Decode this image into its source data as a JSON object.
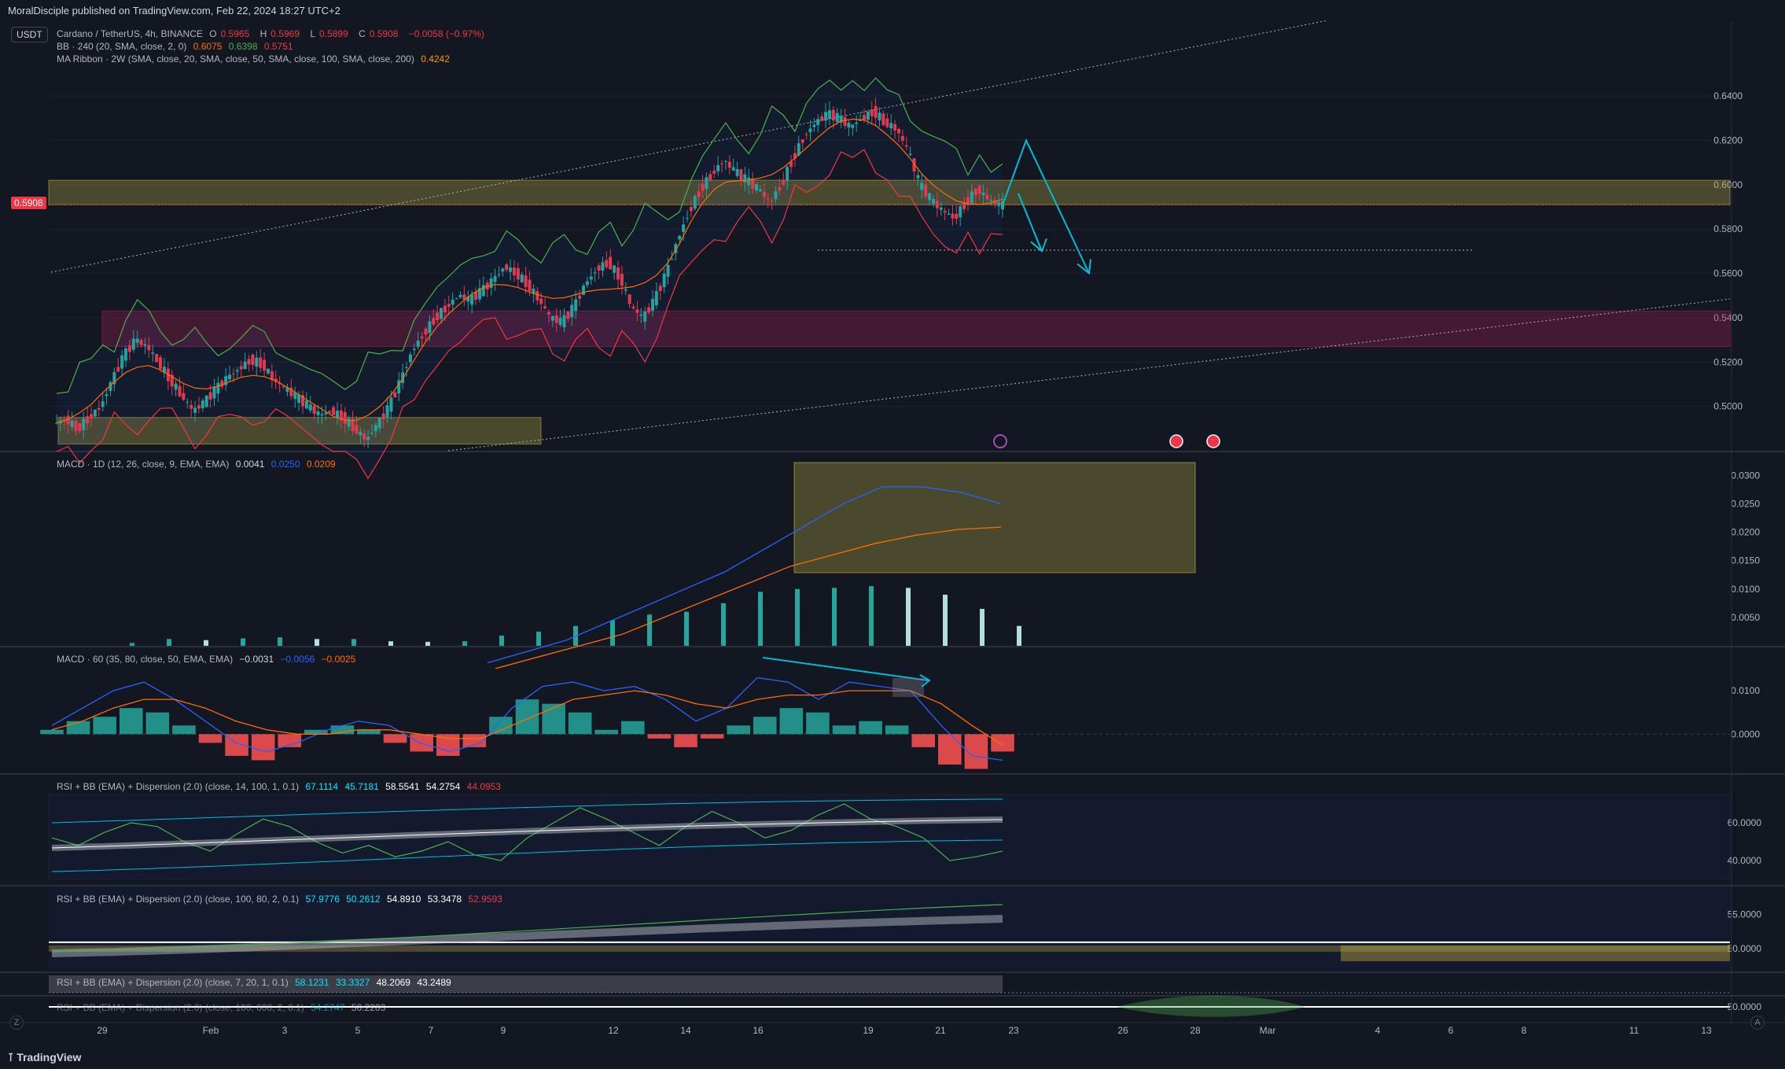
{
  "header": {
    "publisher_line": "MoralDisciple published on TradingView.com, Feb 22, 2024 18:27 UTC+2"
  },
  "symbol_button": "USDT",
  "legend_main": {
    "title": "Cardano / TetherUS, 4h, BINANCE",
    "o_label": "O",
    "o": "0.5965",
    "h_label": "H",
    "h": "0.5969",
    "l_label": "L",
    "l": "0.5899",
    "c_label": "C",
    "c": "0.5908",
    "change": "−0.0058 (−0.97%)"
  },
  "legend_bb": {
    "label": "BB · 240 (20, SMA, close, 2, 0)",
    "v1": "0.6075",
    "v2": "0.6398",
    "v3": "0.5751"
  },
  "legend_ma": {
    "label": "MA Ribbon · 2W (SMA, close, 20, SMA, close, 50, SMA, close, 100, SMA, close, 200)",
    "v1": "0.4242"
  },
  "legend_macd1": {
    "label": "MACD · 1D (12, 26, close, 9, EMA, EMA)",
    "v1": "0.0041",
    "v2": "0.0250",
    "v3": "0.0209"
  },
  "legend_macd2": {
    "label": "MACD · 60 (35, 80, close, 50, EMA, EMA)",
    "v1": "−0.0031",
    "v2": "−0.0056",
    "v3": "−0.0025"
  },
  "legend_rsi1": {
    "label": "RSI + BB (EMA) + Dispersion (2.0) (close, 14, 100, 1, 0.1)",
    "v1": "67.1114",
    "v2": "45.7181",
    "v3": "58.5541",
    "v4": "54.2754",
    "v5": "44.0953"
  },
  "legend_rsi2": {
    "label": "RSI + BB (EMA) + Dispersion (2.0) (close, 100, 80, 2, 0.1)",
    "v1": "57.9776",
    "v2": "50.2612",
    "v3": "54.8910",
    "v4": "53.3478",
    "v5": "52.9593"
  },
  "legend_rsi3": {
    "label": "RSI + BB (EMA) + Dispersion (2.0) (close, 7, 20, 1, 0.1)",
    "v1": "58.1231",
    "v2": "33.3327",
    "v3": "48.2069",
    "v4": "43.2489"
  },
  "legend_rsi4": {
    "label": "RSI + BB (EMA) + Dispersion (2.0) (close, 100, 600, 2, 0.1)",
    "v1": "54.2747",
    "v2": "50.2203"
  },
  "current_price_tag": "0.5908",
  "footer": {
    "brand": "TradingView"
  },
  "colors": {
    "bg": "#131722",
    "up": "#26a69a",
    "down": "#f23645",
    "blue": "#2962ff",
    "orange": "#ff6d00",
    "cyan": "#00bcd4",
    "green": "#4caf50",
    "yellow_zone": "#b5a642",
    "red_zone": "#9c1f4c"
  },
  "chart_data": [
    {
      "type": "candlestick",
      "title": "Cardano / TetherUS, 4h, BINANCE",
      "price_axis_ticks": [
        "0.6400",
        "0.6200",
        "0.6000",
        "0.5800",
        "0.5600",
        "0.5400",
        "0.5200",
        "0.5000"
      ],
      "ylim": [
        0.48,
        0.662
      ],
      "x_ticks": [
        "29",
        "Feb",
        "3",
        "5",
        "7",
        "9",
        "12",
        "14",
        "16",
        "19",
        "21",
        "23",
        "26",
        "28",
        "Mar",
        "4",
        "6",
        "8",
        "11",
        "13"
      ],
      "close_path": [
        0.492,
        0.494,
        0.49,
        0.495,
        0.5,
        0.512,
        0.523,
        0.53,
        0.527,
        0.52,
        0.512,
        0.505,
        0.498,
        0.502,
        0.508,
        0.513,
        0.517,
        0.521,
        0.519,
        0.512,
        0.508,
        0.504,
        0.5,
        0.496,
        0.498,
        0.495,
        0.49,
        0.485,
        0.492,
        0.5,
        0.512,
        0.525,
        0.533,
        0.54,
        0.545,
        0.55,
        0.548,
        0.552,
        0.557,
        0.563,
        0.56,
        0.555,
        0.548,
        0.54,
        0.538,
        0.545,
        0.555,
        0.562,
        0.565,
        0.558,
        0.545,
        0.54,
        0.548,
        0.56,
        0.575,
        0.588,
        0.598,
        0.605,
        0.611,
        0.606,
        0.602,
        0.598,
        0.592,
        0.6,
        0.612,
        0.622,
        0.628,
        0.632,
        0.63,
        0.626,
        0.63,
        0.633,
        0.628,
        0.625,
        0.615,
        0.6,
        0.593,
        0.588,
        0.585,
        0.592,
        0.598,
        0.593,
        0.5908
      ],
      "forecast_arrows": [
        [
          0.5908,
          0.62,
          0.56
        ],
        [
          0.5908,
          0.57
        ]
      ],
      "zones": [
        {
          "from": 0.591,
          "to": 0.602,
          "color": "yellow"
        },
        {
          "from": 0.527,
          "to": 0.543,
          "color": "red"
        },
        {
          "from": 0.483,
          "to": 0.495,
          "color": "yellow"
        }
      ]
    },
    {
      "type": "bar",
      "title": "MACD · 1D (12, 26, close, 9, EMA, EMA)",
      "y_ticks": [
        "0.0300",
        "0.0250",
        "0.0200",
        "0.0150",
        "0.0100",
        "0.0050"
      ],
      "ylim": [
        0.0,
        0.032
      ],
      "histogram": [
        0.0005,
        0.0012,
        0.001,
        0.0013,
        0.0015,
        0.0012,
        0.0012,
        0.0008,
        0.0007,
        0.0008,
        0.0018,
        0.0025,
        0.0035,
        0.0045,
        0.0055,
        0.006,
        0.0075,
        0.0095,
        0.01,
        0.0102,
        0.0105,
        0.0102,
        0.009,
        0.0065,
        0.0035
      ],
      "macd_line": [
        -0.003,
        -0.001,
        0.001,
        0.004,
        0.007,
        0.01,
        0.013,
        0.017,
        0.021,
        0.025,
        0.028,
        0.028,
        0.027,
        0.025
      ],
      "signal_line": [
        -0.004,
        -0.002,
        0.0,
        0.002,
        0.005,
        0.008,
        0.011,
        0.014,
        0.016,
        0.018,
        0.0195,
        0.0205,
        0.0209
      ]
    },
    {
      "type": "bar",
      "title": "MACD · 60 (35, 80, close, 50, EMA, EMA)",
      "y_ticks": [
        "0.0100",
        "0.0000"
      ],
      "ylim": [
        -0.009,
        0.016
      ],
      "histogram": [
        0.001,
        0.003,
        0.004,
        0.006,
        0.005,
        0.002,
        -0.002,
        -0.005,
        -0.006,
        -0.003,
        0.001,
        0.002,
        0.001,
        -0.002,
        -0.004,
        -0.005,
        -0.003,
        0.004,
        0.008,
        0.007,
        0.005,
        0.001,
        0.003,
        -0.001,
        -0.003,
        -0.001,
        0.002,
        0.004,
        0.006,
        0.005,
        0.002,
        0.003,
        0.002,
        -0.003,
        -0.007,
        -0.008,
        -0.004
      ],
      "macd_line": [
        0.002,
        0.006,
        0.01,
        0.012,
        0.008,
        0.003,
        -0.002,
        -0.004,
        -0.002,
        0.001,
        0.003,
        0.002,
        -0.002,
        -0.004,
        -0.002,
        0.006,
        0.011,
        0.012,
        0.01,
        0.011,
        0.008,
        0.003,
        0.006,
        0.013,
        0.012,
        0.008,
        0.012,
        0.011,
        0.01,
        0.002,
        -0.005,
        -0.006
      ],
      "signal_line": [
        0.001,
        0.003,
        0.006,
        0.008,
        0.008,
        0.006,
        0.003,
        0.001,
        0.0,
        0.0,
        0.001,
        0.001,
        0.0,
        -0.001,
        -0.001,
        0.002,
        0.005,
        0.008,
        0.009,
        0.01,
        0.009,
        0.007,
        0.006,
        0.008,
        0.009,
        0.009,
        0.01,
        0.01,
        0.01,
        0.007,
        0.002,
        -0.0025
      ]
    },
    {
      "type": "line",
      "title": "RSI + BB (EMA) + Dispersion (2.0) (close, 14, 100, 1, 0.1)",
      "y_ticks": [
        "60.0000",
        "40.0000"
      ],
      "ylim": [
        30,
        75
      ],
      "rsi": [
        52,
        48,
        55,
        60,
        58,
        50,
        45,
        54,
        62,
        58,
        50,
        44,
        48,
        42,
        45,
        50,
        43,
        40,
        52,
        60,
        68,
        62,
        55,
        48,
        58,
        66,
        60,
        52,
        56,
        64,
        70,
        62,
        58,
        52,
        40,
        42,
        45
      ]
    },
    {
      "type": "line",
      "title": "RSI + BB (EMA) + Dispersion (2.0) (close, 100, 80, 2, 0.1)",
      "y_ticks": [
        "55.0000",
        "50.0000"
      ],
      "ylim": [
        47,
        57
      ]
    },
    {
      "type": "line",
      "title": "RSI + BB (EMA) + Dispersion (2.0) (close, 7, 20, 1, 0.1)",
      "y_ticks": []
    },
    {
      "type": "line",
      "title": "RSI + BB (EMA) + Dispersion (2.0) (close, 100, 600, 2, 0.1)",
      "y_ticks": [
        "50.0000"
      ]
    }
  ]
}
